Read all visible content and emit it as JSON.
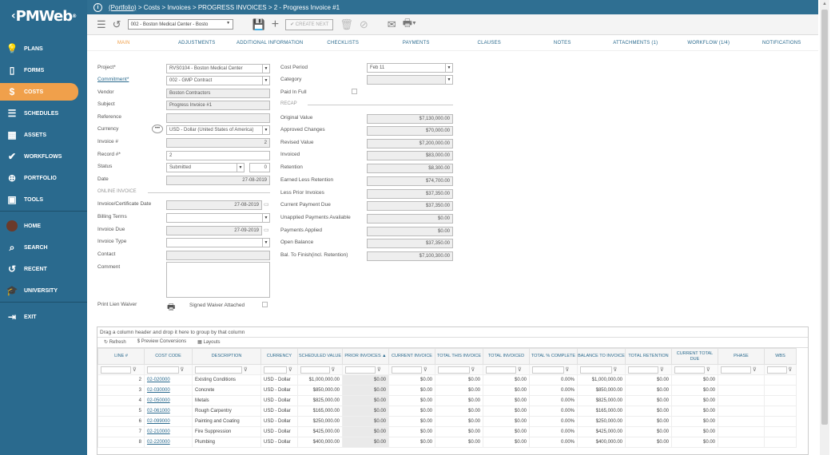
{
  "app": {
    "logo": "PMWeb"
  },
  "sidebar": {
    "items": [
      {
        "label": "PLANS",
        "icon": "lightbulb-icon"
      },
      {
        "label": "FORMS",
        "icon": "document-icon"
      },
      {
        "label": "COSTS",
        "icon": "dollar-icon"
      },
      {
        "label": "SCHEDULES",
        "icon": "gantt-icon"
      },
      {
        "label": "ASSETS",
        "icon": "building-icon"
      },
      {
        "label": "WORKFLOWS",
        "icon": "check-icon"
      },
      {
        "label": "PORTFOLIO",
        "icon": "globe-icon"
      },
      {
        "label": "TOOLS",
        "icon": "briefcase-icon"
      },
      {
        "label": "HOME",
        "icon": "avatar"
      },
      {
        "label": "SEARCH",
        "icon": "search-icon"
      },
      {
        "label": "RECENT",
        "icon": "history-icon"
      },
      {
        "label": "UNIVERSITY",
        "icon": "graduation-cap-icon"
      },
      {
        "label": "EXIT",
        "icon": "exit-icon"
      }
    ]
  },
  "header": {
    "portfolio": "(Portfolio)",
    "breadcrumb": " > Costs > Invoices > PROGRESS INVOICES > 2 - Progress Invoice #1"
  },
  "toolbar": {
    "record_select": "002 - Boston Medical Center - Bosto",
    "create_next": "CREATE NEXT"
  },
  "tabs": [
    "MAIN",
    "ADJUSTMENTS",
    "ADDITIONAL INFORMATION",
    "CHECKLISTS",
    "PAYMENTS",
    "CLAUSES",
    "NOTES",
    "ATTACHMENTS (1)",
    "WORKFLOW (1/4)",
    "NOTIFICATIONS"
  ],
  "form": {
    "project_label": "Project*",
    "project_value": "RVS0104 - Boston Medical Center",
    "commitment_label": "Commitment*",
    "commitment_value": "002 - GMP Contract",
    "vendor_label": "Vendor",
    "vendor_value": "Boston Contractors",
    "subject_label": "Subject",
    "subject_value": "Progress Invoice #1",
    "reference_label": "Reference",
    "reference_value": "",
    "currency_label": "Currency",
    "currency_value": "USD - Dollar (United States of America)",
    "invoice_no_label": "Invoice #",
    "invoice_no_value": "2",
    "record_no_label": "Record #*",
    "record_no_value": "2",
    "status_label": "Status",
    "status_value": "Submitted",
    "status_num": "0",
    "date_label": "Date",
    "date_value": "27-08-2019",
    "online_invoice": "ONLINE INVOICE",
    "cert_date_label": "Invoice/Certificate Date",
    "cert_date_value": "27-08-2019",
    "billing_terms_label": "Billing Terms",
    "invoice_due_label": "Invoice Due",
    "invoice_due_value": "27-09-2019",
    "invoice_type_label": "Invoice Type",
    "contact_label": "Contact",
    "comment_label": "Comment",
    "print_lien_label": "Print Lien Waiver",
    "signed_waiver_label": "Signed Waiver Attached",
    "cost_period_label": "Cost Period",
    "cost_period_value": "Feb 11",
    "category_label": "Category",
    "paid_in_full_label": "Paid In Full",
    "recap": "RECAP",
    "original_value_label": "Original Value",
    "original_value": "$7,130,000.00",
    "approved_changes_label": "Approved Changes",
    "approved_changes": "$70,000.00",
    "revised_value_label": "Revised Value",
    "revised_value": "$7,200,000.00",
    "invoiced_label": "Invoiced",
    "invoiced": "$83,000.00",
    "retention_label": "Retention",
    "retention": "$8,300.00",
    "earned_less_ret_label": "Earned Less Retention",
    "earned_less_ret": "$74,700.00",
    "less_prior_label": "Less Prior Invoices",
    "less_prior": "$37,350.00",
    "current_due_label": "Current Payment Due",
    "current_due": "$37,350.00",
    "unapplied_label": "Unapplied Payments Available",
    "unapplied": "$0.00",
    "applied_label": "Payments Applied",
    "applied": "$0.00",
    "open_balance_label": "Open Balance",
    "open_balance": "$37,350.00",
    "bal_finish_label": "Bal. To Finish(incl. Retention)",
    "bal_finish": "$7,100,300.00"
  },
  "grid": {
    "drag_hint": "Drag a column header and drop it here to group by that column",
    "refresh": "Refresh",
    "preview": "Preview Conversions",
    "layouts": "Layouts",
    "columns": [
      "LINE #",
      "COST CODE",
      "DESCRIPTION",
      "CURRENCY",
      "SCHEDULED VALUE",
      "PRIOR INVOICES ▲",
      "CURRENT INVOICE",
      "TOTAL THIS INVOICE",
      "TOTAL INVOICED",
      "TOTAL % COMPLETE",
      "BALANCE TO INVOICE",
      "TOTAL RETENTION",
      "CURRENT TOTAL DUE",
      "PHASE",
      "WBS"
    ],
    "rows": [
      [
        "2",
        "02-020000",
        "Existing Conditions",
        "USD - Dollar",
        "$1,000,000.00",
        "$0.00",
        "$0.00",
        "$0.00",
        "$0.00",
        "0.00%",
        "$1,000,000.00",
        "$0.00",
        "$0.00"
      ],
      [
        "3",
        "02-030000",
        "Concrete",
        "USD - Dollar",
        "$850,000.00",
        "$0.00",
        "$0.00",
        "$0.00",
        "$0.00",
        "0.00%",
        "$850,000.00",
        "$0.00",
        "$0.00"
      ],
      [
        "4",
        "02-050000",
        "Metals",
        "USD - Dollar",
        "$825,000.00",
        "$0.00",
        "$0.00",
        "$0.00",
        "$0.00",
        "0.00%",
        "$825,000.00",
        "$0.00",
        "$0.00"
      ],
      [
        "5",
        "02-061000",
        "Rough Carpentry",
        "USD - Dollar",
        "$165,000.00",
        "$0.00",
        "$0.00",
        "$0.00",
        "$0.00",
        "0.00%",
        "$165,000.00",
        "$0.00",
        "$0.00"
      ],
      [
        "6",
        "02-099000",
        "Painting and Coating",
        "USD - Dollar",
        "$250,000.00",
        "$0.00",
        "$0.00",
        "$0.00",
        "$0.00",
        "0.00%",
        "$250,000.00",
        "$0.00",
        "$0.00"
      ],
      [
        "7",
        "02-210000",
        "Fire Suppression",
        "USD - Dollar",
        "$425,000.00",
        "$0.00",
        "$0.00",
        "$0.00",
        "$0.00",
        "0.00%",
        "$425,000.00",
        "$0.00",
        "$0.00"
      ],
      [
        "8",
        "02-220000",
        "Plumbing",
        "USD - Dollar",
        "$400,000.00",
        "$0.00",
        "$0.00",
        "$0.00",
        "$0.00",
        "0.00%",
        "$400,000.00",
        "$0.00",
        "$0.00"
      ]
    ]
  }
}
